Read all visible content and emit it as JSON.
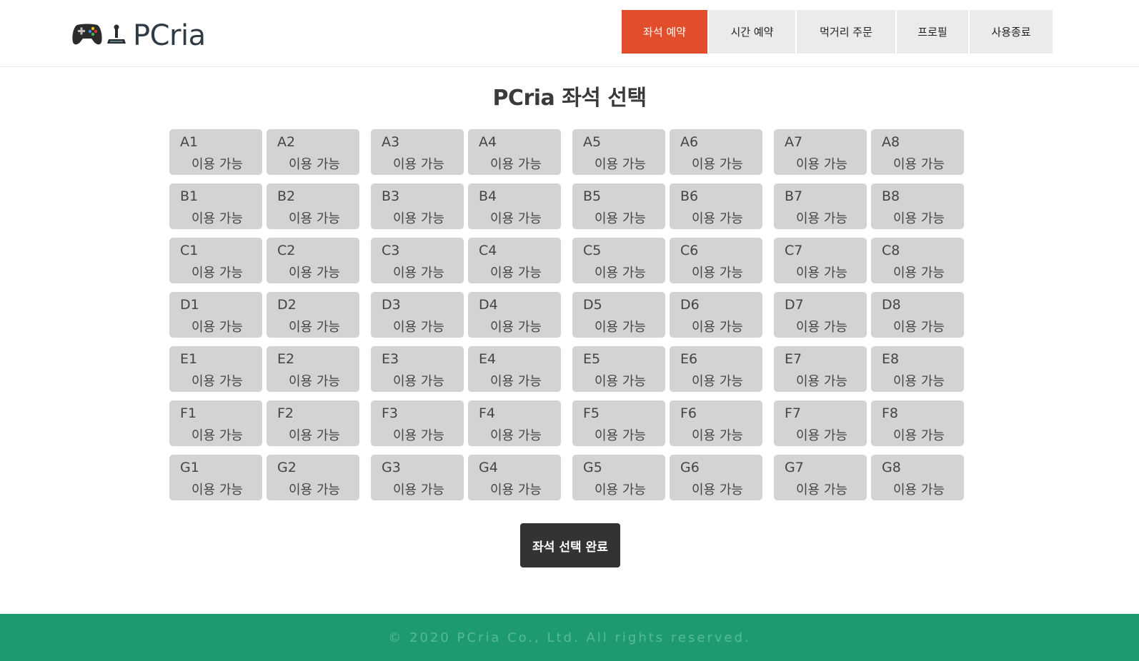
{
  "brand": {
    "name": "PCria",
    "icons": [
      "gamepad-icon",
      "joystick-icon"
    ]
  },
  "nav": {
    "items": [
      {
        "label": "좌석 예약",
        "active": true
      },
      {
        "label": "시간 예약",
        "active": false
      },
      {
        "label": "먹거리 주문",
        "active": false
      },
      {
        "label": "프로필",
        "active": false
      },
      {
        "label": "사용종료",
        "active": false
      }
    ]
  },
  "page": {
    "title": "PCria 좌석 선택"
  },
  "seats": {
    "rows": [
      [
        {
          "id": "A1",
          "status": "이용 가능"
        },
        {
          "id": "A2",
          "status": "이용 가능"
        },
        {
          "id": "A3",
          "status": "이용 가능"
        },
        {
          "id": "A4",
          "status": "이용 가능"
        },
        {
          "id": "A5",
          "status": "이용 가능"
        },
        {
          "id": "A6",
          "status": "이용 가능"
        },
        {
          "id": "A7",
          "status": "이용 가능"
        },
        {
          "id": "A8",
          "status": "이용 가능"
        }
      ],
      [
        {
          "id": "B1",
          "status": "이용 가능"
        },
        {
          "id": "B2",
          "status": "이용 가능"
        },
        {
          "id": "B3",
          "status": "이용 가능"
        },
        {
          "id": "B4",
          "status": "이용 가능"
        },
        {
          "id": "B5",
          "status": "이용 가능"
        },
        {
          "id": "B6",
          "status": "이용 가능"
        },
        {
          "id": "B7",
          "status": "이용 가능"
        },
        {
          "id": "B8",
          "status": "이용 가능"
        }
      ],
      [
        {
          "id": "C1",
          "status": "이용 가능"
        },
        {
          "id": "C2",
          "status": "이용 가능"
        },
        {
          "id": "C3",
          "status": "이용 가능"
        },
        {
          "id": "C4",
          "status": "이용 가능"
        },
        {
          "id": "C5",
          "status": "이용 가능"
        },
        {
          "id": "C6",
          "status": "이용 가능"
        },
        {
          "id": "C7",
          "status": "이용 가능"
        },
        {
          "id": "C8",
          "status": "이용 가능"
        }
      ],
      [
        {
          "id": "D1",
          "status": "이용 가능"
        },
        {
          "id": "D2",
          "status": "이용 가능"
        },
        {
          "id": "D3",
          "status": "이용 가능"
        },
        {
          "id": "D4",
          "status": "이용 가능"
        },
        {
          "id": "D5",
          "status": "이용 가능"
        },
        {
          "id": "D6",
          "status": "이용 가능"
        },
        {
          "id": "D7",
          "status": "이용 가능"
        },
        {
          "id": "D8",
          "status": "이용 가능"
        }
      ],
      [
        {
          "id": "E1",
          "status": "이용 가능"
        },
        {
          "id": "E2",
          "status": "이용 가능"
        },
        {
          "id": "E3",
          "status": "이용 가능"
        },
        {
          "id": "E4",
          "status": "이용 가능"
        },
        {
          "id": "E5",
          "status": "이용 가능"
        },
        {
          "id": "E6",
          "status": "이용 가능"
        },
        {
          "id": "E7",
          "status": "이용 가능"
        },
        {
          "id": "E8",
          "status": "이용 가능"
        }
      ],
      [
        {
          "id": "F1",
          "status": "이용 가능"
        },
        {
          "id": "F2",
          "status": "이용 가능"
        },
        {
          "id": "F3",
          "status": "이용 가능"
        },
        {
          "id": "F4",
          "status": "이용 가능"
        },
        {
          "id": "F5",
          "status": "이용 가능"
        },
        {
          "id": "F6",
          "status": "이용 가능"
        },
        {
          "id": "F7",
          "status": "이용 가능"
        },
        {
          "id": "F8",
          "status": "이용 가능"
        }
      ],
      [
        {
          "id": "G1",
          "status": "이용 가능"
        },
        {
          "id": "G2",
          "status": "이용 가능"
        },
        {
          "id": "G3",
          "status": "이용 가능"
        },
        {
          "id": "G4",
          "status": "이용 가능"
        },
        {
          "id": "G5",
          "status": "이용 가능"
        },
        {
          "id": "G6",
          "status": "이용 가능"
        },
        {
          "id": "G7",
          "status": "이용 가능"
        },
        {
          "id": "G8",
          "status": "이용 가능"
        }
      ]
    ]
  },
  "actions": {
    "confirm_label": "좌석 선택 완료"
  },
  "footer": {
    "copyright": "© 2020 PCria Co., Ltd. All rights reserved."
  },
  "colors": {
    "accent": "#e24e2b",
    "nav_bg": "#ebebeb",
    "seat_bg": "#d3d3d3",
    "button_bg": "#333333",
    "footer_bg": "#1e9a72",
    "footer_text": "#56bb97"
  }
}
